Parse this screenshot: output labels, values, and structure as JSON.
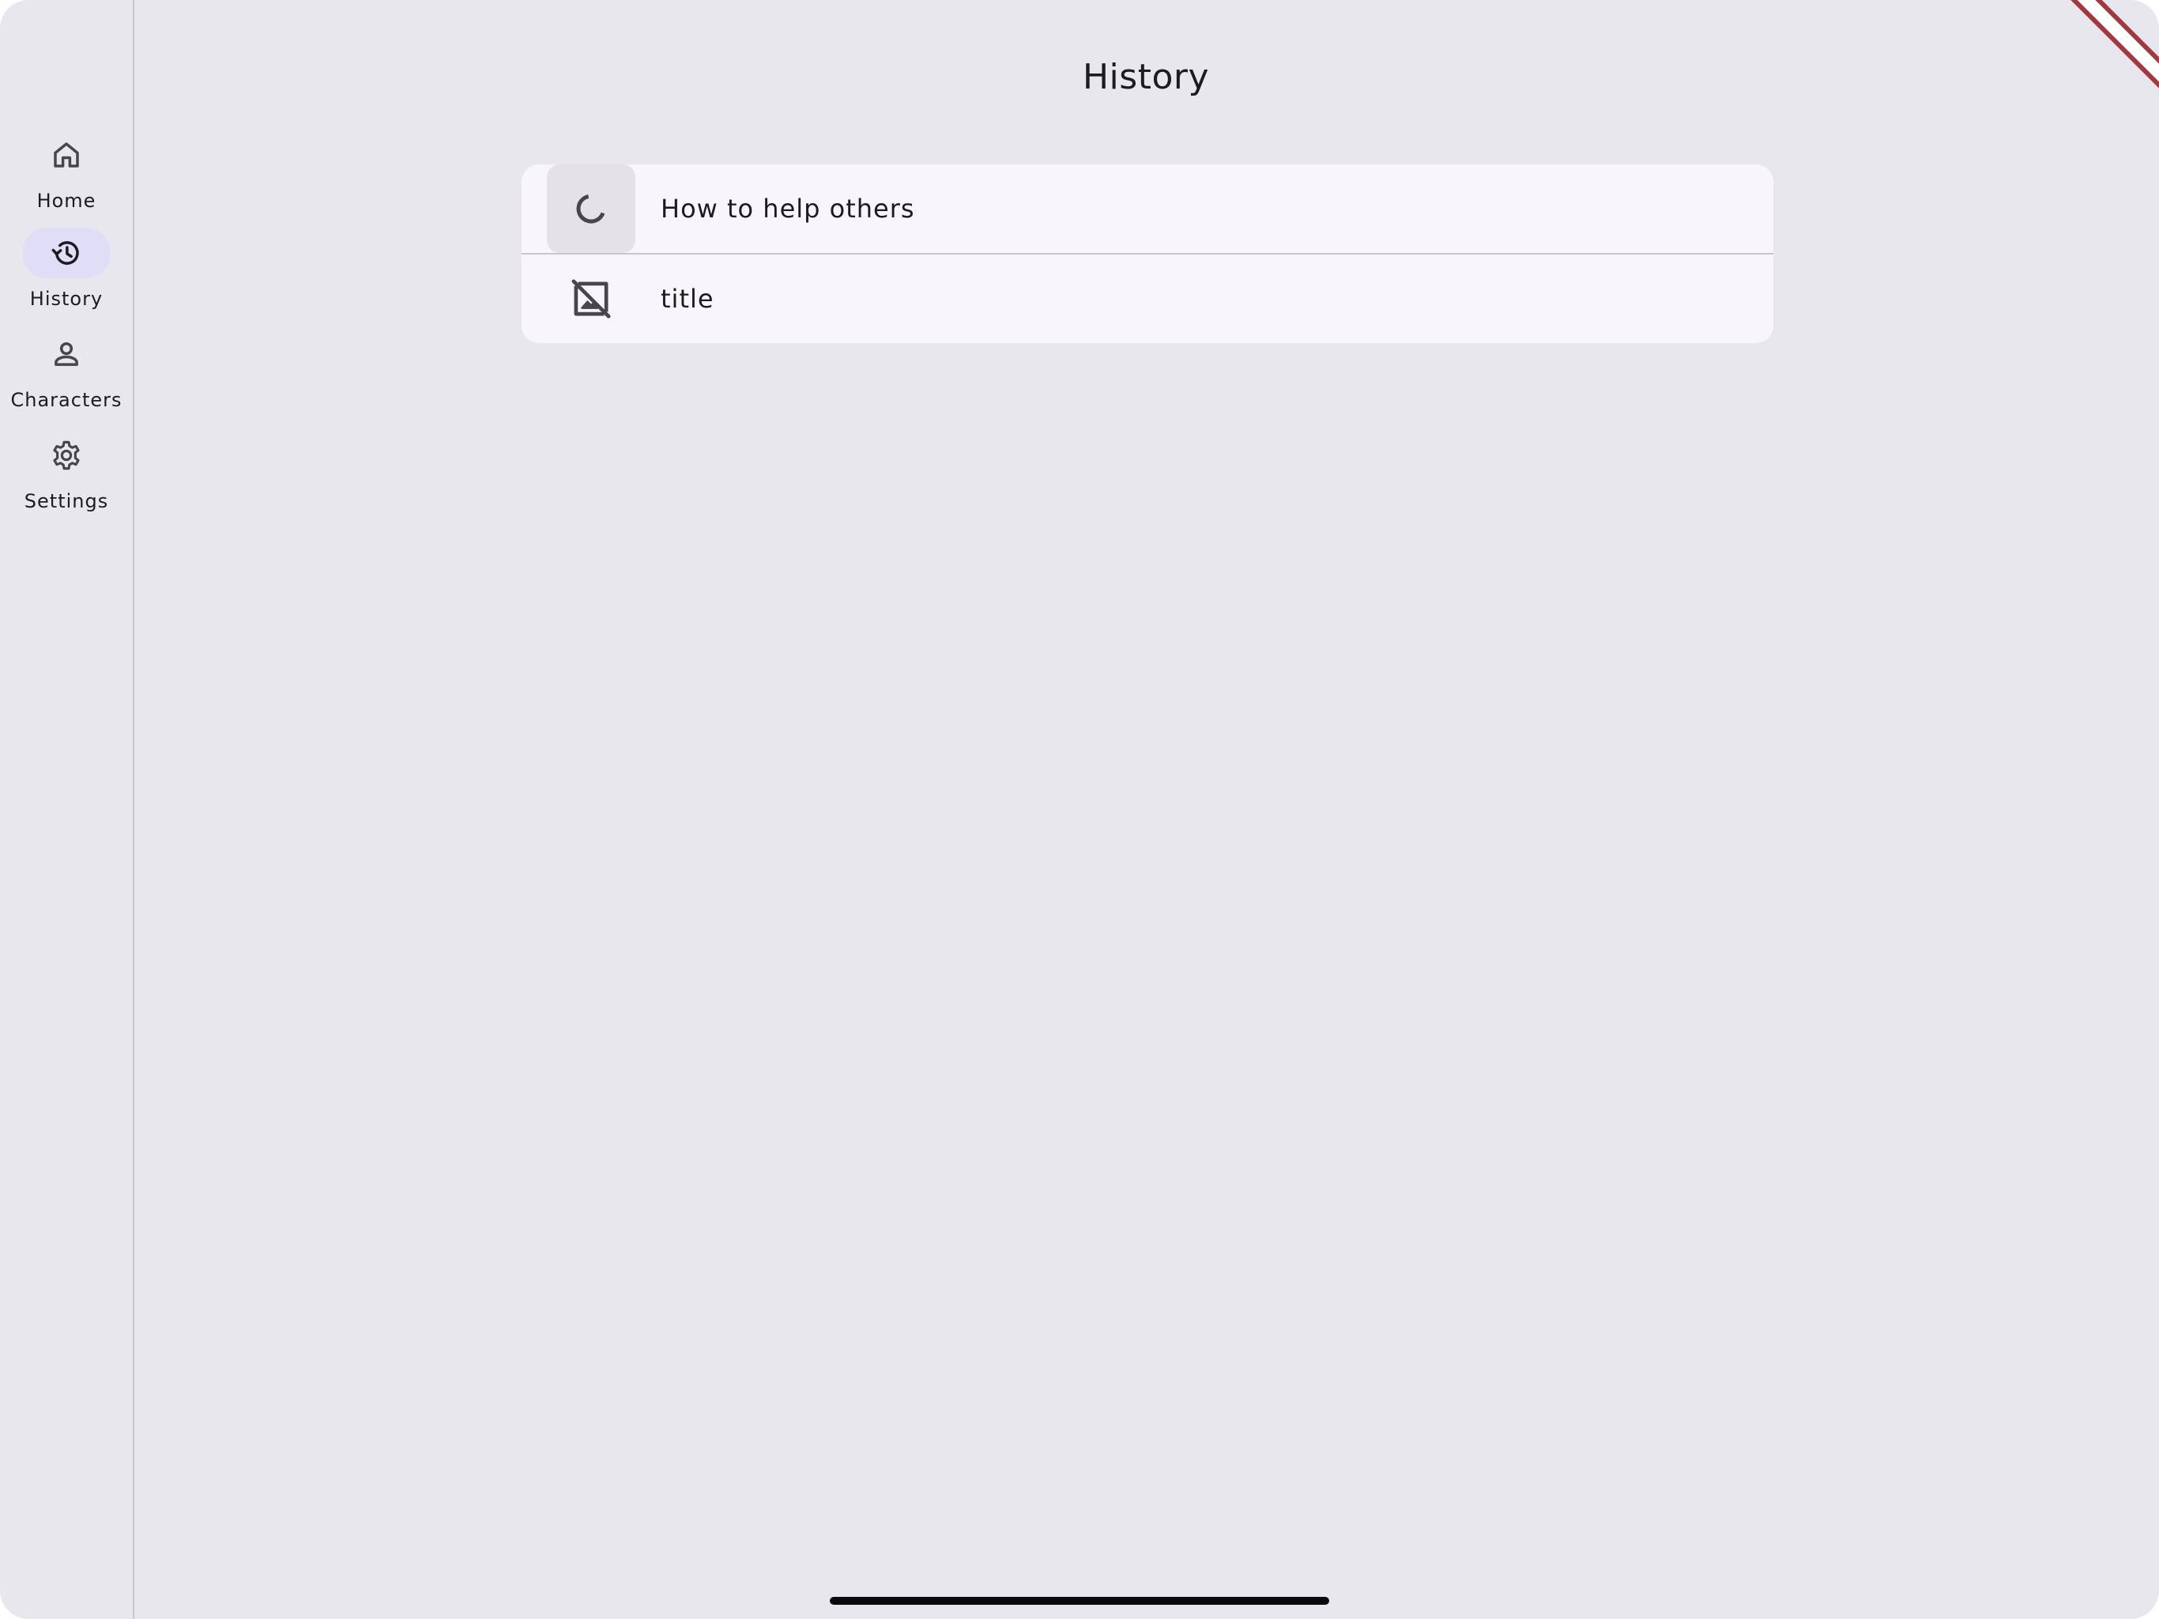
{
  "header": {
    "title": "History"
  },
  "nav": {
    "items": [
      {
        "label": "Home",
        "icon": "home-icon",
        "active": false
      },
      {
        "label": "History",
        "icon": "history-icon",
        "active": true
      },
      {
        "label": "Characters",
        "icon": "person-icon",
        "active": false
      },
      {
        "label": "Settings",
        "icon": "gear-icon",
        "active": false
      }
    ]
  },
  "history": {
    "items": [
      {
        "title": "How to help others",
        "thumbnail": "loading-spinner"
      },
      {
        "title": "title",
        "thumbnail": "image-not-supported-icon"
      }
    ]
  },
  "colors": {
    "background": "#e9e7ee",
    "card": "#f8f6fc",
    "active_indicator": "#e0def6",
    "debug_banner": "#a13a3f"
  }
}
